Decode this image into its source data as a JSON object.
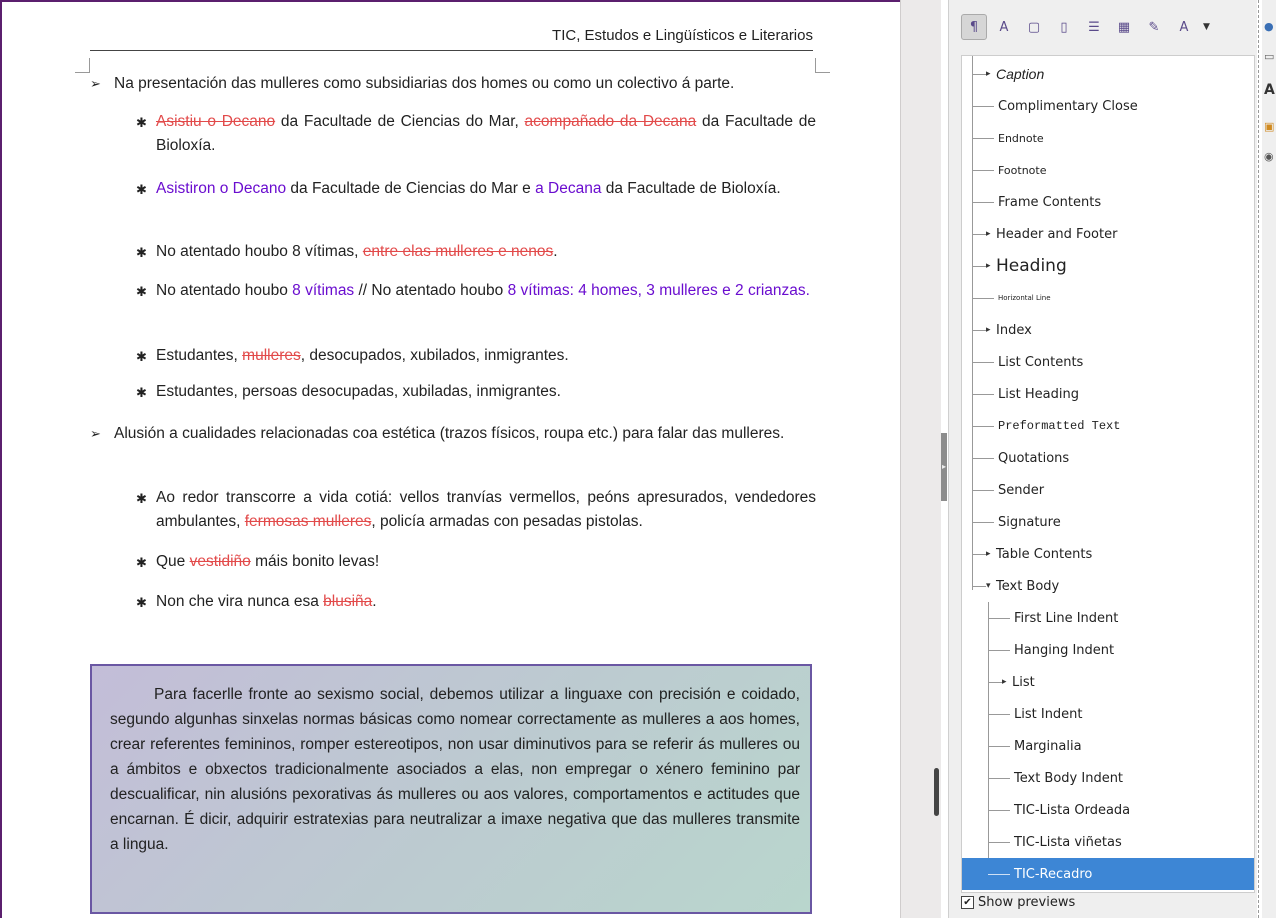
{
  "document": {
    "header": "TIC, Estudos e Lingüísticos e Literarios",
    "level1": [
      {
        "text": "Na presentación das mulleres como subsidiarias dos homes ou como un colectivo á parte."
      },
      {
        "text": "Alusión a cualidades relacionadas coa estética (trazos físicos, roupa etc.) para falar das mulleres."
      }
    ],
    "items": {
      "i1": {
        "del_a": "Asistiu o Decano",
        "plain_a": " da Facultade de Ciencias do Mar, ",
        "del_b": "acompañado da Decana",
        "plain_b": " da Facultade de Bioloxía."
      },
      "i2": {
        "ins_a": "Asistiron o Decano",
        "plain_a": " da Facultade de Ciencias do Mar e ",
        "ins_b": "a Decana",
        "plain_b": " da Facultade de Bioloxía."
      },
      "i3": {
        "plain_a": "No atentado houbo 8 vítimas, ",
        "del_a": "entre elas mulleres e nenos",
        "plain_b": "."
      },
      "i4": {
        "plain_a": "No atentado houbo ",
        "ins_a": "8 vítimas",
        "plain_b": " // No atentado houbo ",
        "ins_b": "8 vítimas: 4 homes, 3 mulleres e 2 crianzas."
      },
      "i5": {
        "plain_a": "Estudantes, ",
        "del_a": "mulleres",
        "plain_b": ", desocupados, xubilados, inmigrantes."
      },
      "i6": {
        "plain_a": "Estudantes, persoas desocupadas, xubiladas, inmigrantes."
      },
      "i7": {
        "plain_a": "Ao redor transcorre a vida cotiá: vellos tranvías vermellos, peóns apresurados, vendedores ambulantes, ",
        "del_a": "fermosas mulleres",
        "plain_b": ",  policía armadas con pesadas pistolas."
      },
      "i8": {
        "plain_a": "Que ",
        "del_a": "vestidiño",
        "plain_b": " máis bonito levas!"
      },
      "i9": {
        "plain_a": "Non che vira nunca esa ",
        "del_a": "blusiña",
        "plain_b": "."
      }
    },
    "recadro": "Para facerlle fronte ao sexismo social, debemos utilizar a linguaxe con precisión e coidado, segundo algunhas sinxelas normas básicas como nomear correctamente as mulleres a aos homes, crear referentes femininos, romper estereotipos, non usar diminutivos para se referir ás mulleres ou a ámbitos e obxectos tradicionalmente asociados a elas, non empregar o xénero feminino par descualificar, nin alusións pexorativas ás mulleres ou aos valores, comportamentos e actitudes que encarnan. É dicir, adquirir estratexias para neutralizar a imaxe negativa que das mulleres transmite a lingua."
  },
  "sidebar": {
    "toolbar_icons": [
      "paragraph-styles-icon",
      "character-styles-icon",
      "frame-styles-icon",
      "page-styles-icon",
      "list-styles-icon",
      "table-styles-icon",
      "fill-format-icon",
      "new-style-icon"
    ],
    "styles": [
      {
        "label": "Caption",
        "expander": "▸"
      },
      {
        "label": "Complimentary Close"
      },
      {
        "label": "Endnote"
      },
      {
        "label": "Footnote"
      },
      {
        "label": "Frame Contents"
      },
      {
        "label": "Header and Footer",
        "expander": "▸"
      },
      {
        "label": "Heading",
        "expander": "▸"
      },
      {
        "label": "Horizontal Line"
      },
      {
        "label": "Index",
        "expander": "▸"
      },
      {
        "label": "List Contents"
      },
      {
        "label": "List Heading"
      },
      {
        "label": "Preformatted Text"
      },
      {
        "label": "Quotations"
      },
      {
        "label": "Sender"
      },
      {
        "label": "Signature"
      },
      {
        "label": "Table Contents",
        "expander": "▸"
      },
      {
        "label": "Text Body",
        "expander": "▾"
      },
      {
        "label": "First Line Indent"
      },
      {
        "label": "Hanging Indent"
      },
      {
        "label": "List",
        "expander": "▸"
      },
      {
        "label": "List Indent"
      },
      {
        "label": "Marginalia"
      },
      {
        "label": "Text Body Indent"
      },
      {
        "label": "TIC-Lista Ordeada"
      },
      {
        "label": "TIC-Lista viñetas"
      },
      {
        "label": "TIC-Recadro"
      }
    ],
    "selected": "TIC-Recadro",
    "show_previews": "Show previews",
    "show_previews_checked": "✔"
  },
  "colors": {
    "deleted": "#e24a4a",
    "inserted": "#6a0dcf",
    "selection": "#3d86d5",
    "page_border": "#5b1f6e"
  }
}
